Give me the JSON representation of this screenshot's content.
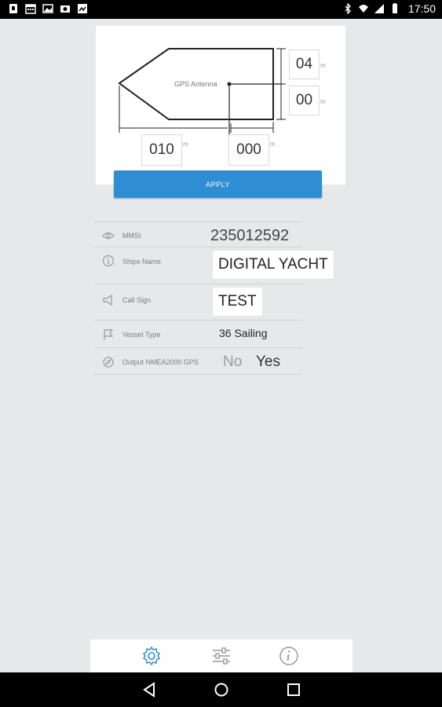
{
  "status_bar": {
    "time": "17:50"
  },
  "diagram": {
    "gps_label": "GPS Antenna",
    "dim_top_right": "04",
    "dim_bottom_right": "00",
    "dim_bottom_left": "010",
    "dim_bottom_center": "000",
    "unit": "m"
  },
  "apply_label": "APPLY",
  "settings": {
    "mmsi_label": "MMSI",
    "mmsi_value": "235012592",
    "ships_name_label": "Ships Name",
    "ships_name_value": "DIGITAL YACHT",
    "call_sign_label": "Call Sign",
    "call_sign_value": "TEST",
    "vessel_type_label": "Vessel Type",
    "vessel_type_value": "36 Sailing",
    "nmea_label": "Output NMEA2000 GPS",
    "nmea_no": "No",
    "nmea_yes": "Yes"
  },
  "tabs": [
    "gear-icon",
    "sliders-icon",
    "info-icon"
  ],
  "colors": {
    "accent": "#2f8dd4",
    "background": "#e6e8ea"
  }
}
